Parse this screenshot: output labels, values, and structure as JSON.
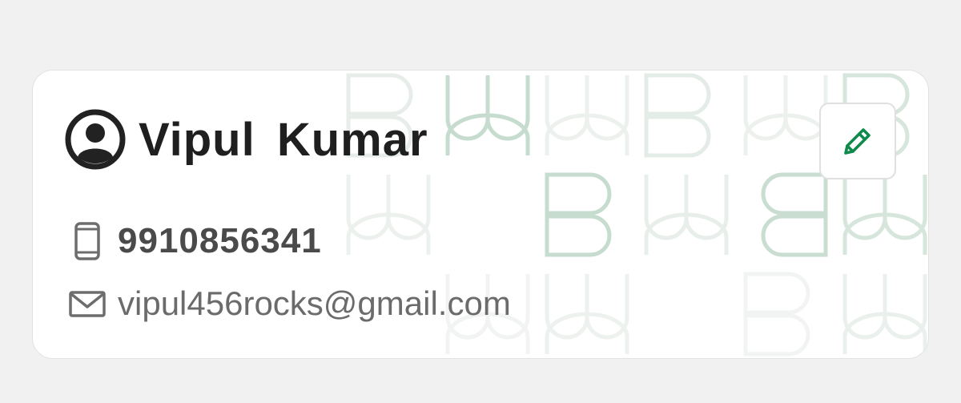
{
  "profile_card": {
    "name": "Vipul  Kumar",
    "phone": "9910856341",
    "email": "vipul456rocks@gmail.com"
  },
  "icons": {
    "avatar": "user-circle-icon",
    "edit": "pencil-icon",
    "phone": "mobile-phone-icon",
    "email": "envelope-icon"
  },
  "colors": {
    "accent": "#0f8a4c",
    "pattern": "#bcd9c8",
    "name_text": "#1f1f1f",
    "phone_text": "#4a4a4a",
    "email_text": "#6b6b6b"
  }
}
